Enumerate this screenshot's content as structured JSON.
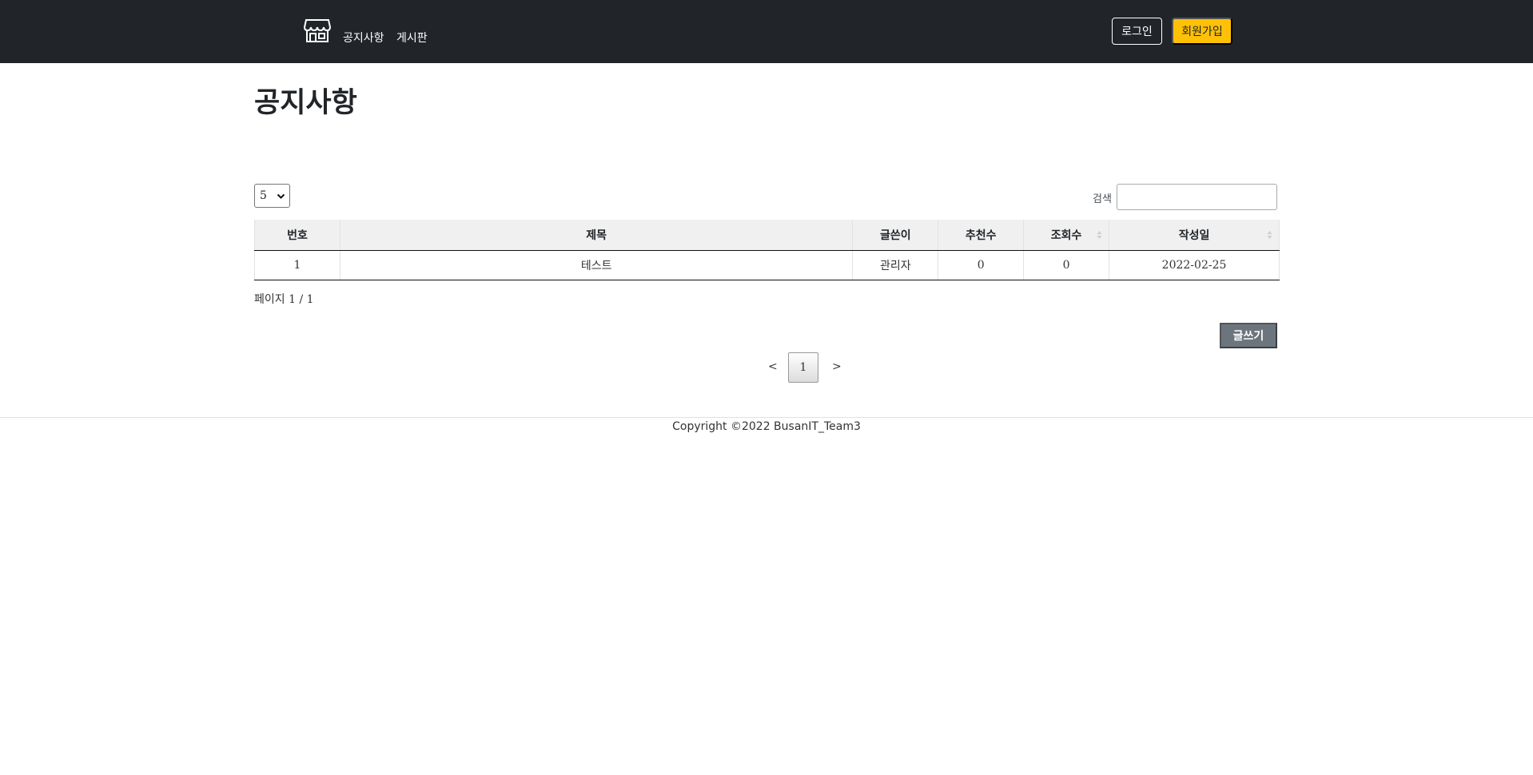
{
  "nav": {
    "brand_icon": "store-icon",
    "links": [
      "공지사항",
      "게시판"
    ],
    "login_label": "로그인",
    "signup_label": "회원가입"
  },
  "page": {
    "title": "공지사항"
  },
  "table_controls": {
    "page_length": "5",
    "search_label": "검색",
    "search_value": ""
  },
  "table": {
    "headers": [
      "번호",
      "제목",
      "글쓴이",
      "추천수",
      "조회수",
      "작성일"
    ],
    "rows": [
      [
        "1",
        "테스트",
        "관리자",
        "0",
        "0",
        "2022-02-25"
      ]
    ]
  },
  "page_info": "페이지 1 / 1",
  "write_button_label": "글쓰기",
  "pagination": {
    "prev": "<",
    "current": "1",
    "next": ">"
  },
  "footer": {
    "copyright": "Copyright ©2022 BusanIT_Team3"
  },
  "colors": {
    "navbar": "#212529",
    "signup_button": "#ffc107",
    "write_button": "#6c757d"
  }
}
